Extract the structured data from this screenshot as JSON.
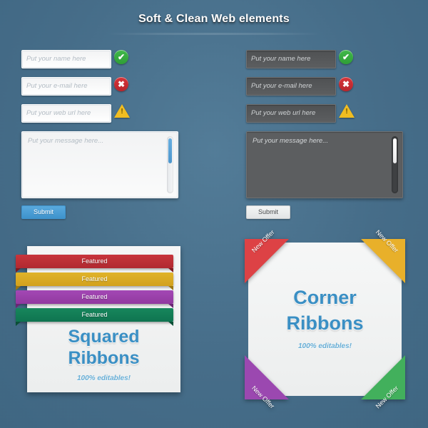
{
  "header": {
    "title": "Soft & Clean Web elements"
  },
  "forms": [
    {
      "variant": "light",
      "fields": [
        {
          "placeholder": "Put your name here",
          "status": "check-icon"
        },
        {
          "placeholder": "Put your e-mail here",
          "status": "error-icon"
        },
        {
          "placeholder": "Put your web url here",
          "status": "warning-icon"
        }
      ],
      "textarea_placeholder": "Put your message here...",
      "submit_label": "Submit"
    },
    {
      "variant": "dark",
      "fields": [
        {
          "placeholder": "Put your name here",
          "status": "check-icon"
        },
        {
          "placeholder": "Put your e-mail here",
          "status": "error-icon"
        },
        {
          "placeholder": "Put your web url here",
          "status": "warning-icon"
        }
      ],
      "textarea_placeholder": "Put your message here...",
      "submit_label": "Submit"
    }
  ],
  "icons": {
    "check_glyph": "✔",
    "error_glyph": "✖",
    "warning_glyph": "!"
  },
  "squared_ribbons": {
    "ribbons": [
      {
        "label": "Featured",
        "color": "#c8353c"
      },
      {
        "label": "Featured",
        "color": "#e0b32a"
      },
      {
        "label": "Featured",
        "color": "#a348b5"
      },
      {
        "label": "Featured",
        "color": "#17865c"
      }
    ],
    "heading_line1": "Squared",
    "heading_line2": "Ribbons",
    "subtitle": "100% editables!"
  },
  "corner_ribbons": {
    "corners": [
      {
        "position": "top-left",
        "label": "New Offer",
        "color": "#dd4245"
      },
      {
        "position": "top-right",
        "label": "New Offer",
        "color": "#e8b02a"
      },
      {
        "position": "bottom-left",
        "label": "New Offer",
        "color": "#9b48b0"
      },
      {
        "position": "bottom-right",
        "label": "New Offer",
        "color": "#42b05c"
      }
    ],
    "heading_line1": "Corner",
    "heading_line2": "Ribbons",
    "subtitle": "100% editables!"
  },
  "theme": {
    "background": "#4a7490",
    "accent_blue": "#3a8fc4",
    "button_blue": "#4a9fd8"
  }
}
